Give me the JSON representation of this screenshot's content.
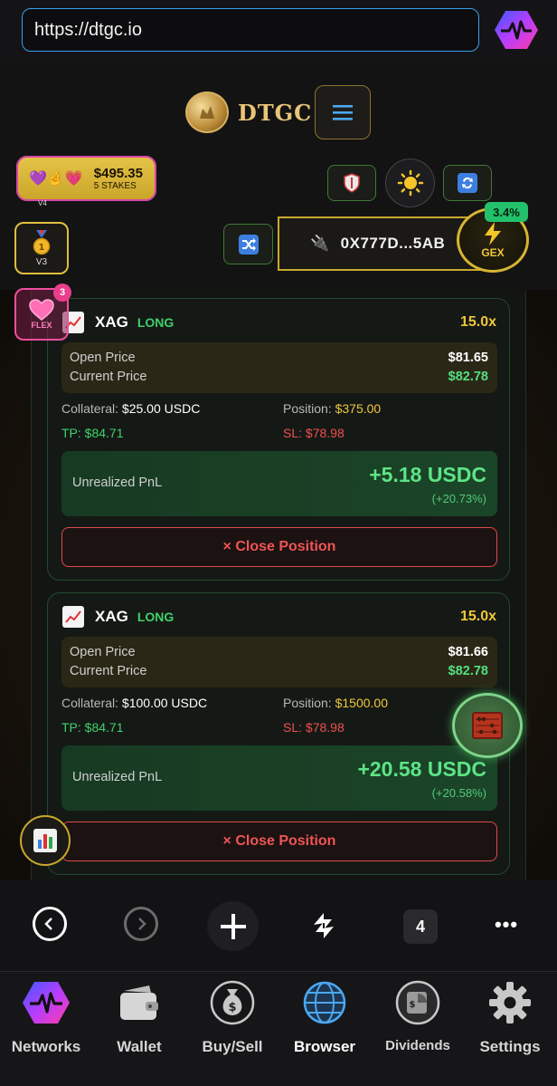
{
  "browser": {
    "url": "https://dtgc.io"
  },
  "app": {
    "logo_text": "DTGC",
    "stakes": {
      "emoji": "💜🤞💗",
      "amount": "$495.35",
      "count": "5 STAKES",
      "version": "V4"
    },
    "v3_label": "V3",
    "wallet_address": "0X777D...5AB",
    "gex": {
      "label": "GEX",
      "badge": "3.4%"
    },
    "flex": {
      "label": "FLEX",
      "badge": "3"
    }
  },
  "positions": [
    {
      "asset": "XAG",
      "side": "LONG",
      "leverage": "15.0x",
      "open_price_label": "Open Price",
      "open_price": "$81.65",
      "current_price_label": "Current Price",
      "current_price": "$82.78",
      "collateral_label": "Collateral:",
      "collateral": "$25.00 USDC",
      "position_label": "Position:",
      "position": "$375.00",
      "tp_label": "TP:",
      "tp": "$84.71",
      "sl_label": "SL:",
      "sl": "$78.98",
      "pnl_label": "Unrealized PnL",
      "pnl": "+5.18 USDC",
      "pnl_pct": "(+20.73%)",
      "close_label": "× Close Position"
    },
    {
      "asset": "XAG",
      "side": "LONG",
      "leverage": "15.0x",
      "open_price_label": "Open Price",
      "open_price": "$81.66",
      "current_price_label": "Current Price",
      "current_price": "$82.78",
      "collateral_label": "Collateral:",
      "collateral": "$100.00 USDC",
      "position_label": "Position:",
      "position": "$1500.00",
      "tp_label": "TP:",
      "tp": "$84.71",
      "sl_label": "SL:",
      "sl": "$78.98",
      "pnl_label": "Unrealized PnL",
      "pnl": "+20.58 USDC",
      "pnl_pct": "(+20.58%)",
      "close_label": "× Close Position"
    }
  ],
  "browser_nav": {
    "tab_count": "4",
    "more": "•••"
  },
  "tabs": [
    {
      "label": "Networks",
      "icon": "pulse-icon"
    },
    {
      "label": "Wallet",
      "icon": "wallet-icon"
    },
    {
      "label": "Buy/Sell",
      "icon": "money-bag-icon"
    },
    {
      "label": "Browser",
      "icon": "globe-icon",
      "active": true
    },
    {
      "label": "Dividends",
      "icon": "dividends-icon"
    },
    {
      "label": "Settings",
      "icon": "gear-icon"
    }
  ],
  "colors": {
    "accent_gold": "#f0c73d",
    "profit_green": "#5de486",
    "loss_red": "#ef5050",
    "url_border": "#3aa0e8"
  }
}
